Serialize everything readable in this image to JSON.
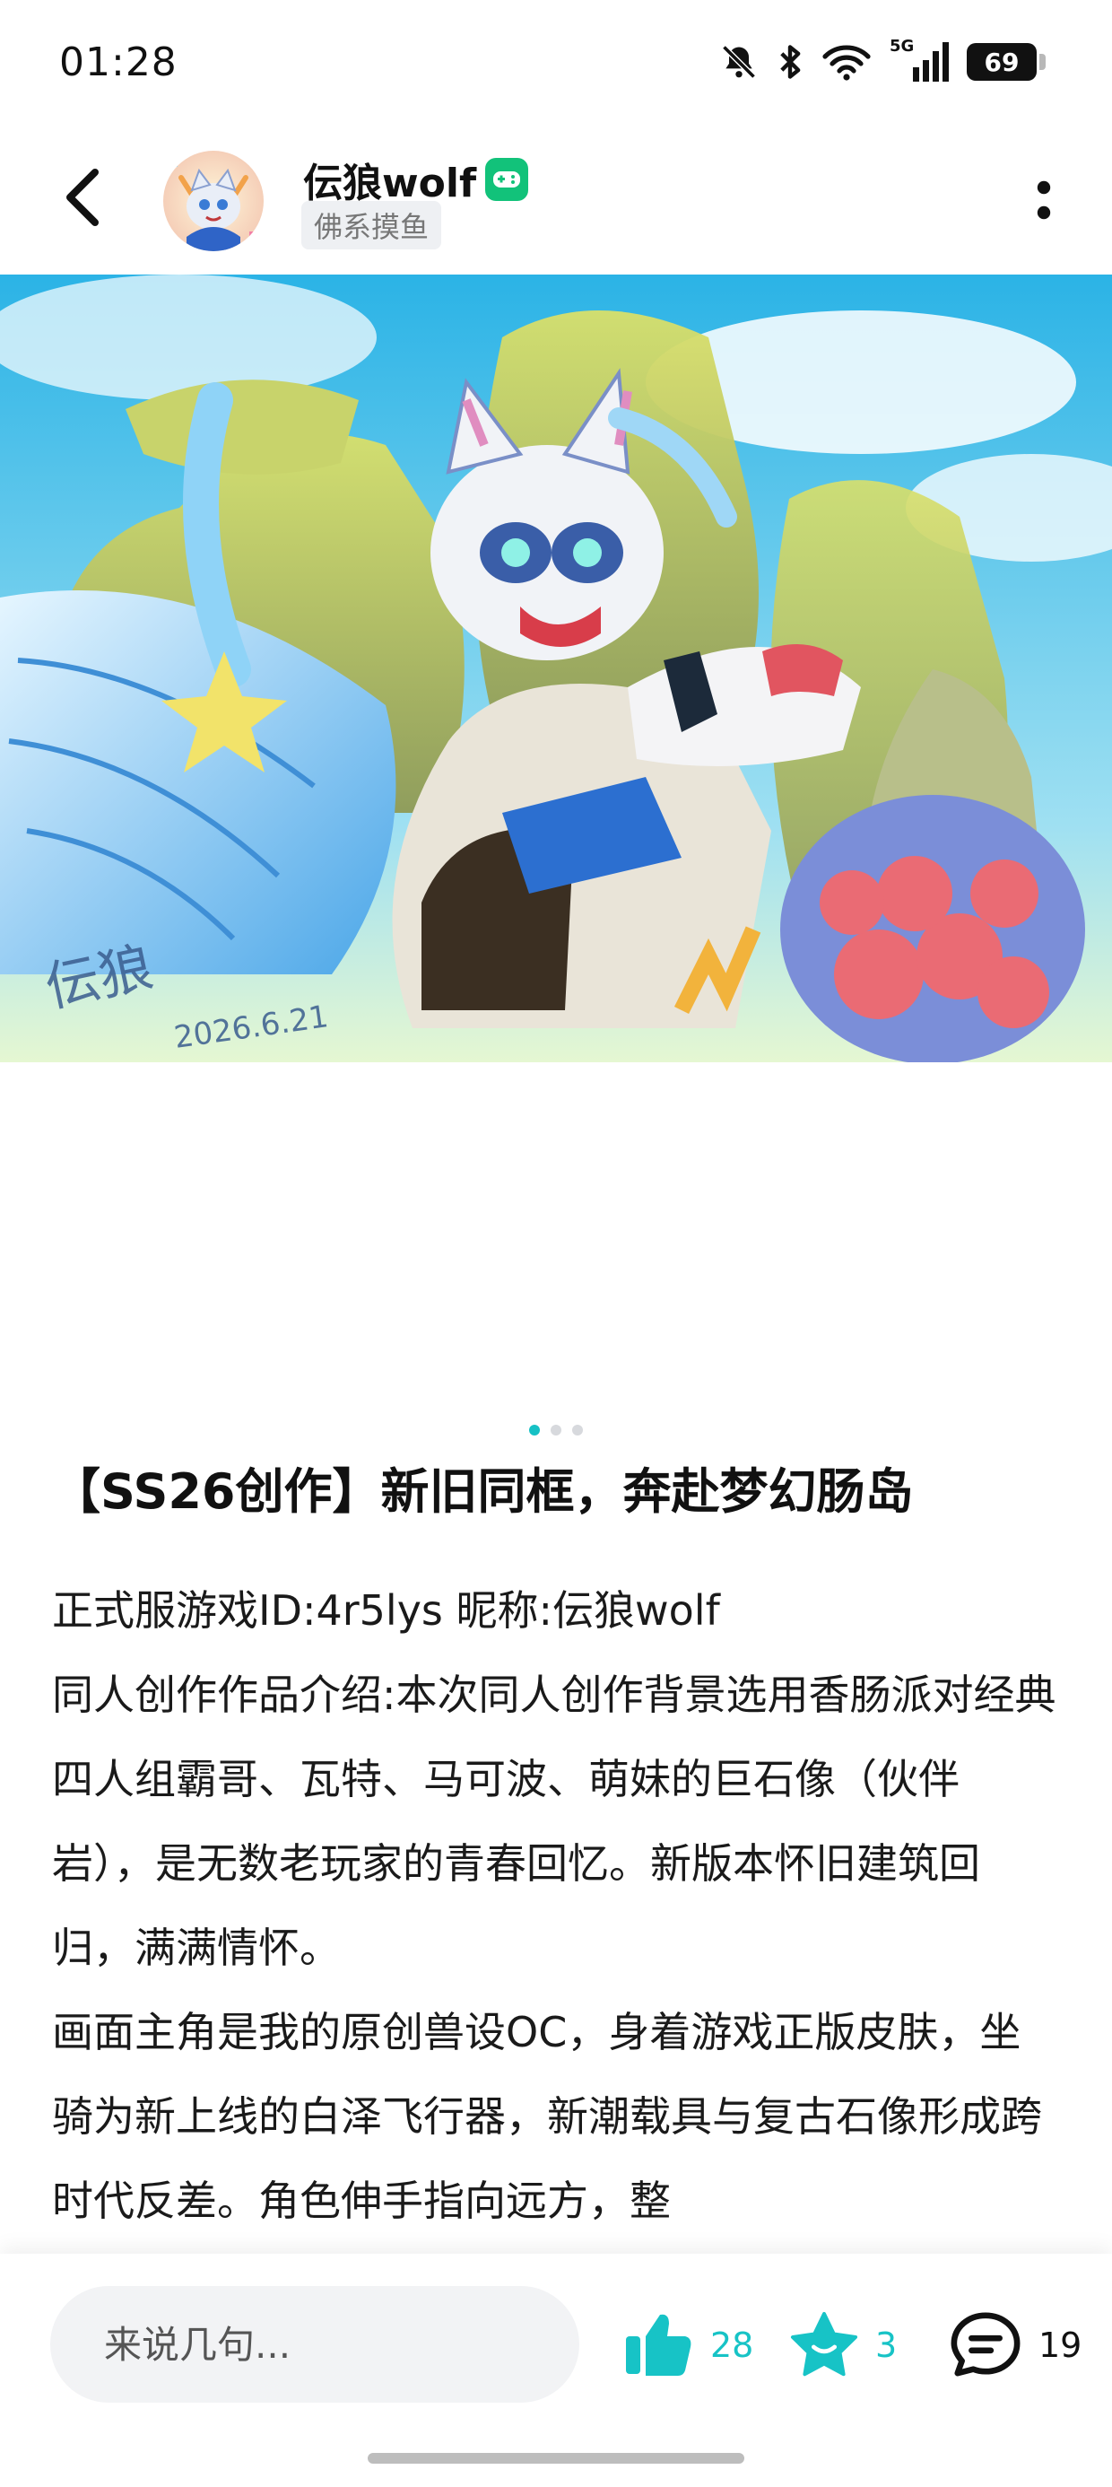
{
  "status_bar": {
    "time": "01:28",
    "network": "5G",
    "battery": "69",
    "icons": [
      "mute-icon",
      "bluetooth-icon",
      "wifi-icon",
      "signal-icon",
      "battery-icon"
    ]
  },
  "header": {
    "username": "伝狼wolf",
    "user_tag": "佛系摸鱼",
    "back_icon": "chevron-left-icon",
    "more_icon": "more-vertical-icon",
    "badge_icon": "game-controller-badge-icon"
  },
  "artwork": {
    "signature": "伝狼",
    "signature_date": "2026.6.21"
  },
  "carousel": {
    "total": 3,
    "active": 0
  },
  "post": {
    "title": "【SS26创作】新旧同框，奔赴梦幻肠岛",
    "paragraphs": [
      "正式服游戏ID:4r5lys 昵称:伝狼wolf",
      "同人创作作品介绍:本次同人创作背景选用香肠派对经典四人组霸哥、瓦特、马可波、萌妹的巨石像（伙伴岩），是无数老玩家的青春回忆。新版本怀旧建筑回归，满满情怀。",
      "画面主角是我的原创兽设OC，身着游戏正版皮肤，坐骑为新上线的白泽飞行器，新潮载具与复古石像形成跨时代反差。角色伸手指向远方，整"
    ]
  },
  "bottom_bar": {
    "comment_placeholder": "来说几句...",
    "like_count": "28",
    "favorite_count": "3",
    "comment_count": "19"
  },
  "colors": {
    "accent": "#17c3c6",
    "badge_green": "#12c27a",
    "text": "#111111",
    "input_bg": "#f2f3f5"
  }
}
